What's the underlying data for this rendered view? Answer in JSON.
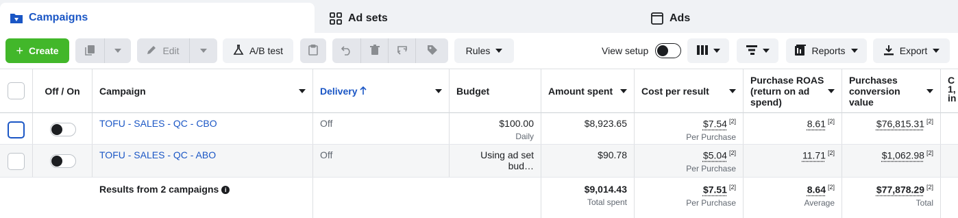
{
  "tabs": [
    {
      "label": "Campaigns",
      "icon": "campaigns-folder-icon",
      "active": true
    },
    {
      "label": "Ad sets",
      "icon": "ad-sets-grid-icon",
      "active": false
    },
    {
      "label": "Ads",
      "icon": "ads-window-icon",
      "active": false
    }
  ],
  "toolbar": {
    "create_label": "Create",
    "edit_label": "Edit",
    "ab_test_label": "A/B test",
    "rules_label": "Rules",
    "view_setup_label": "View setup",
    "reports_label": "Reports",
    "export_label": "Export"
  },
  "columns": {
    "off_on": "Off / On",
    "campaign": "Campaign",
    "delivery": "Delivery",
    "budget": "Budget",
    "amount_spent": "Amount spent",
    "cost_per_result": "Cost per result",
    "purchase_roas_1": "Purchase ROAS",
    "purchase_roas_2": "(return on ad",
    "purchase_roas_3": "spend)",
    "pcv_1": "Purchases",
    "pcv_2": "conversion value",
    "next_1": "C",
    "next_2": "1,",
    "next_3": "in"
  },
  "rows": [
    {
      "campaign": "TOFU - SALES - QC - CBO",
      "delivery": "Off",
      "budget": "$100.00",
      "budget_sub": "Daily",
      "amount_spent": "$8,923.65",
      "cost_per_result": "$7.54",
      "cost_per_result_sup": "[2]",
      "cost_per_result_sub": "Per Purchase",
      "roas": "8.61",
      "roas_sup": "[2]",
      "pcv": "$76,815.31",
      "pcv_sup": "[2]"
    },
    {
      "campaign": "TOFU - SALES - QC - ABO",
      "delivery": "Off",
      "budget": "Using ad set bud…",
      "budget_sub": "",
      "amount_spent": "$90.78",
      "cost_per_result": "$5.04",
      "cost_per_result_sup": "[2]",
      "cost_per_result_sub": "Per Purchase",
      "roas": "11.71",
      "roas_sup": "[2]",
      "pcv": "$1,062.98",
      "pcv_sup": "[2]"
    }
  ],
  "summary": {
    "label": "Results from 2 campaigns",
    "amount_spent": "$9,014.43",
    "amount_spent_sub": "Total spent",
    "cost_per_result": "$7.51",
    "cost_per_result_sup": "[2]",
    "cost_per_result_sub": "Per Purchase",
    "roas": "8.64",
    "roas_sup": "[2]",
    "roas_sub": "Average",
    "pcv": "$77,878.29",
    "pcv_sup": "[2]",
    "pcv_sub": "Total"
  },
  "colors": {
    "accent": "#1a56c5",
    "create_green": "#42b72a",
    "row_alt": "#f5f6f7"
  }
}
